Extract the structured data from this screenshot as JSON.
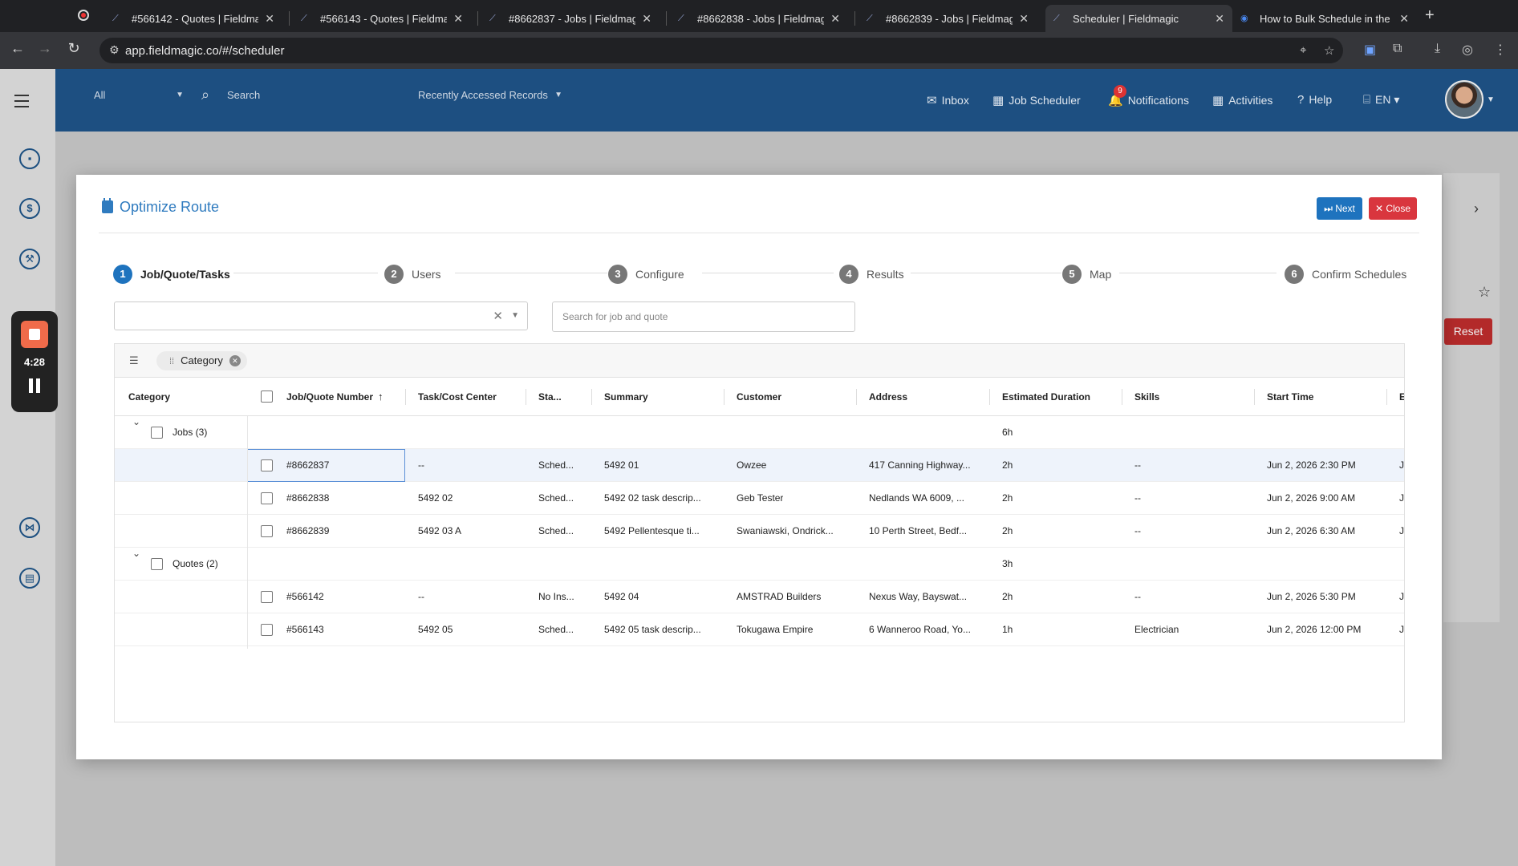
{
  "browser": {
    "tabs": [
      {
        "title": "#566142 - Quotes | Fieldmag",
        "icon": "fieldmagic-icon"
      },
      {
        "title": "#566143 - Quotes | Fieldmag",
        "icon": "fieldmagic-icon"
      },
      {
        "title": "#8662837 - Jobs | Fieldmag",
        "icon": "fieldmagic-icon"
      },
      {
        "title": "#8662838 - Jobs | Fieldmag",
        "icon": "fieldmagic-icon"
      },
      {
        "title": "#8662839 - Jobs | Fieldmag",
        "icon": "fieldmagic-icon"
      },
      {
        "title": "Scheduler | Fieldmagic",
        "icon": "fieldmagic-icon",
        "active": true
      },
      {
        "title": "How to Bulk Schedule in the",
        "icon": "help-doc-icon"
      }
    ],
    "url": "app.fieldmagic.co/#/scheduler"
  },
  "app_header": {
    "scope_select": "All",
    "search_placeholder": "Search",
    "recent_records": "Recently Accessed Records",
    "links": {
      "inbox": "Inbox",
      "job_scheduler": "Job Scheduler",
      "notifications": "Notifications",
      "notifications_count": "9",
      "activities": "Activities",
      "help": "Help",
      "language": "EN"
    }
  },
  "recorder": {
    "time": "4:28"
  },
  "background": {
    "reset_label": "Reset"
  },
  "modal": {
    "title": "Optimize Route",
    "next_label": "Next",
    "close_label": "Close",
    "steps": [
      {
        "num": "1",
        "label": "Job/Quote/Tasks",
        "active": true
      },
      {
        "num": "2",
        "label": "Users"
      },
      {
        "num": "3",
        "label": "Configure"
      },
      {
        "num": "4",
        "label": "Results"
      },
      {
        "num": "5",
        "label": "Map"
      },
      {
        "num": "6",
        "label": "Confirm Schedules"
      }
    ],
    "search_placeholder": "Search for job and quote",
    "group_chip": "Category",
    "columns": {
      "category": "Category",
      "number": "Job/Quote Number",
      "task": "Task/Cost Center",
      "status": "Sta...",
      "summary": "Summary",
      "customer": "Customer",
      "address": "Address",
      "duration": "Estimated Duration",
      "skills": "Skills",
      "start": "Start Time",
      "end": "E"
    },
    "groups": [
      {
        "label": "Jobs (3)",
        "duration": "6h",
        "rows": [
          {
            "number": "#8662837",
            "task": "--",
            "status": "Sched...",
            "summary": "5492 01",
            "customer": "Owzee",
            "address": "417 Canning Highway...",
            "duration": "2h",
            "skills": "--",
            "start": "Jun 2, 2026 2:30 PM",
            "end": "J"
          },
          {
            "number": "#8662838",
            "task": "5492 02",
            "status": "Sched...",
            "summary": "5492 02 task descrip...",
            "customer": "Geb Tester",
            "address": "Nedlands WA 6009, ...",
            "duration": "2h",
            "skills": "--",
            "start": "Jun 2, 2026 9:00 AM",
            "end": "J"
          },
          {
            "number": "#8662839",
            "task": "5492 03 A",
            "status": "Sched...",
            "summary": "5492 Pellentesque ti...",
            "customer": "Swaniawski, Ondrick...",
            "address": "10 Perth Street, Bedf...",
            "duration": "2h",
            "skills": "--",
            "start": "Jun 2, 2026 6:30 AM",
            "end": "J"
          }
        ]
      },
      {
        "label": "Quotes (2)",
        "duration": "3h",
        "rows": [
          {
            "number": "#566142",
            "task": "--",
            "status": "No Ins...",
            "summary": "5492 04",
            "customer": "AMSTRAD Builders",
            "address": "Nexus Way, Bayswat...",
            "duration": "2h",
            "skills": "--",
            "start": "Jun 2, 2026 5:30 PM",
            "end": "J"
          },
          {
            "number": "#566143",
            "task": "5492 05",
            "status": "Sched...",
            "summary": "5492 05 task descrip...",
            "customer": "Tokugawa Empire",
            "address": "6 Wanneroo Road, Yo...",
            "duration": "1h",
            "skills": "Electrician",
            "start": "Jun 2, 2026 12:00 PM",
            "end": "J"
          }
        ]
      }
    ]
  }
}
